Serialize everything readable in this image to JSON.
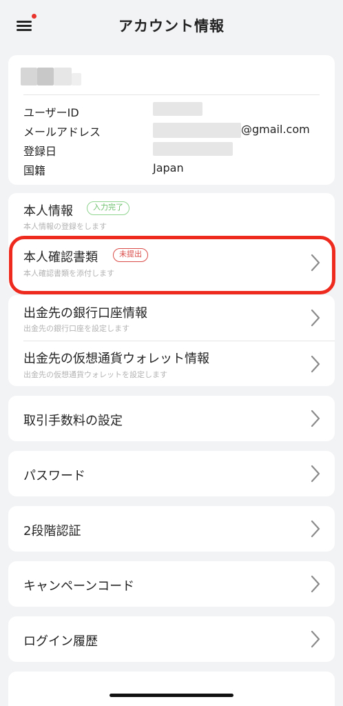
{
  "header": {
    "title": "アカウント情報"
  },
  "profile": {
    "rows": [
      {
        "label": "ユーザーID",
        "value": ""
      },
      {
        "label": "メールアドレス",
        "value": "@gmail.com"
      },
      {
        "label": "登録日",
        "value": ""
      },
      {
        "label": "国籍",
        "value": "Japan"
      }
    ]
  },
  "identity": {
    "personal": {
      "title": "本人情報",
      "badge": "入力完了",
      "subtitle": "本人情報の登録をします"
    },
    "documents": {
      "title": "本人確認書類",
      "badge": "未提出",
      "subtitle": "本人確認書類を添付します"
    }
  },
  "withdrawal": {
    "bank": {
      "title": "出金先の銀行口座情報",
      "subtitle": "出金先の銀行口座を設定します"
    },
    "crypto": {
      "title": "出金先の仮想通貨ウォレット情報",
      "subtitle": "出金先の仮想通貨ウォレットを設定します"
    }
  },
  "menu": [
    {
      "title": "取引手数料の設定"
    },
    {
      "title": "パスワード"
    },
    {
      "title": "2段階認証"
    },
    {
      "title": "キャンペーンコード"
    },
    {
      "title": "ログイン履歴"
    }
  ],
  "colors": {
    "background": "#f2f3f5",
    "card": "#ffffff",
    "highlight": "#ee2a1e",
    "badge_done": "#6cbf6c",
    "badge_pending": "#d94a46",
    "notification_dot": "#e8342c"
  },
  "icons": {
    "menu": "hamburger-icon",
    "chevron": "chevron-right-icon"
  }
}
